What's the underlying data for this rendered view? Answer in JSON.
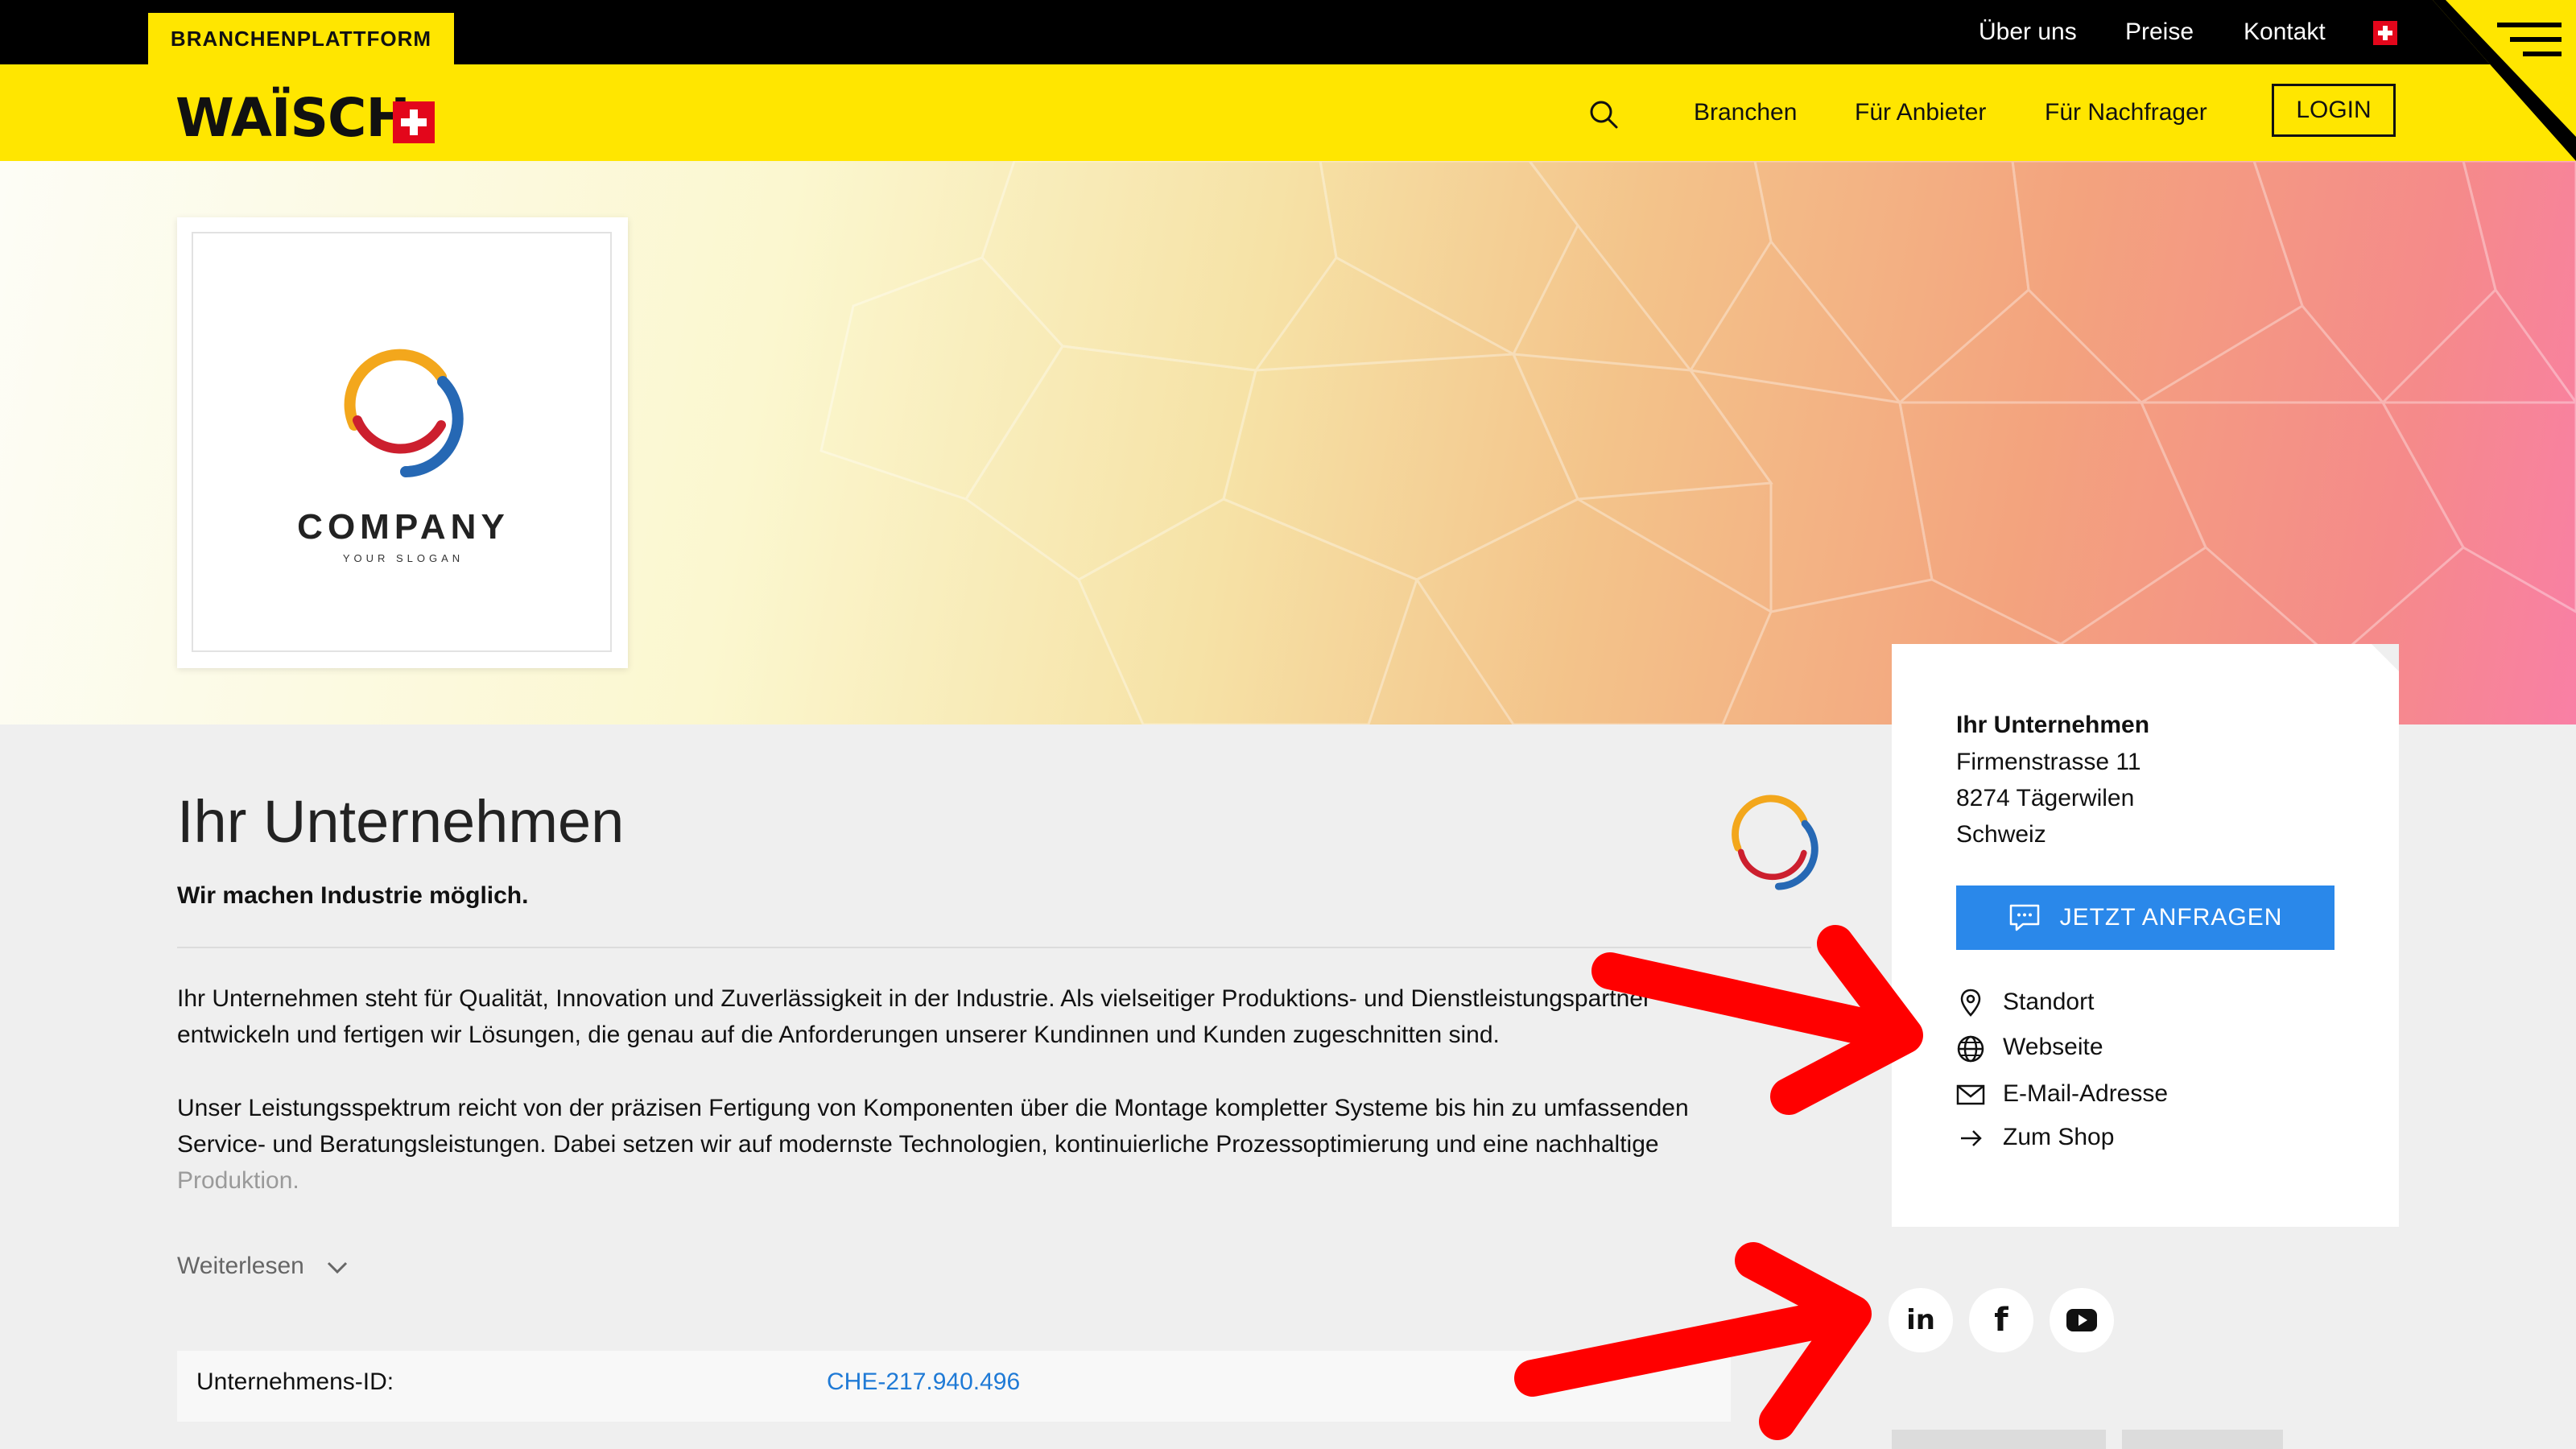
{
  "top_bar": {
    "brand_tab": "BRANCHENPLATTFORM",
    "links": [
      "Über uns",
      "Preise",
      "Kontakt"
    ]
  },
  "nav": {
    "logo_text": "WAÏSCH",
    "links": [
      "Branchen",
      "Für Anbieter",
      "Für Nachfrager"
    ],
    "login_label": "LOGIN"
  },
  "logo_card": {
    "company": "COMPANY",
    "slogan": "YOUR SLOGAN"
  },
  "main": {
    "title": "Ihr Unternehmen",
    "subtitle": "Wir machen Industrie möglich.",
    "paragraphs": [
      "Ihr Unternehmen steht für Qualität, Innovation und Zuverlässigkeit in der Industrie. Als vielseitiger Produktions- und Dienstleistungspartner entwickeln und fertigen wir Lösungen, die genau auf die Anforderungen unserer Kundinnen und Kunden zugeschnitten sind.",
      "Unser Leistungsspektrum reicht von der präzisen Fertigung von Komponenten über die Montage kompletter Systeme bis hin zu umfassenden Service- und Beratungsleistungen. Dabei setzen wir auf modernste Technologien, kontinuierliche Prozessoptimierung und eine nachhaltige",
      "Produktion."
    ],
    "read_more": "Weiterlesen",
    "table": {
      "label": "Unternehmens-ID:",
      "value": "CHE-217.940.496"
    }
  },
  "contact": {
    "name": "Ihr Unternehmen",
    "street": "Firmenstrasse 11",
    "city": "8274 Tägerwilen",
    "country": "Schweiz",
    "cta": "JETZT ANFRAGEN",
    "links": [
      "Standort",
      "Webseite",
      "E-Mail-Adresse",
      "Zum Shop"
    ]
  },
  "social": [
    "linkedin",
    "facebook",
    "youtube"
  ],
  "colors": {
    "brand_yellow": "#ffe600",
    "swiss_red": "#e3061b",
    "cta_blue": "#2a88ea",
    "link_blue": "#1f7ad6",
    "annotation_red": "#ff0000"
  }
}
